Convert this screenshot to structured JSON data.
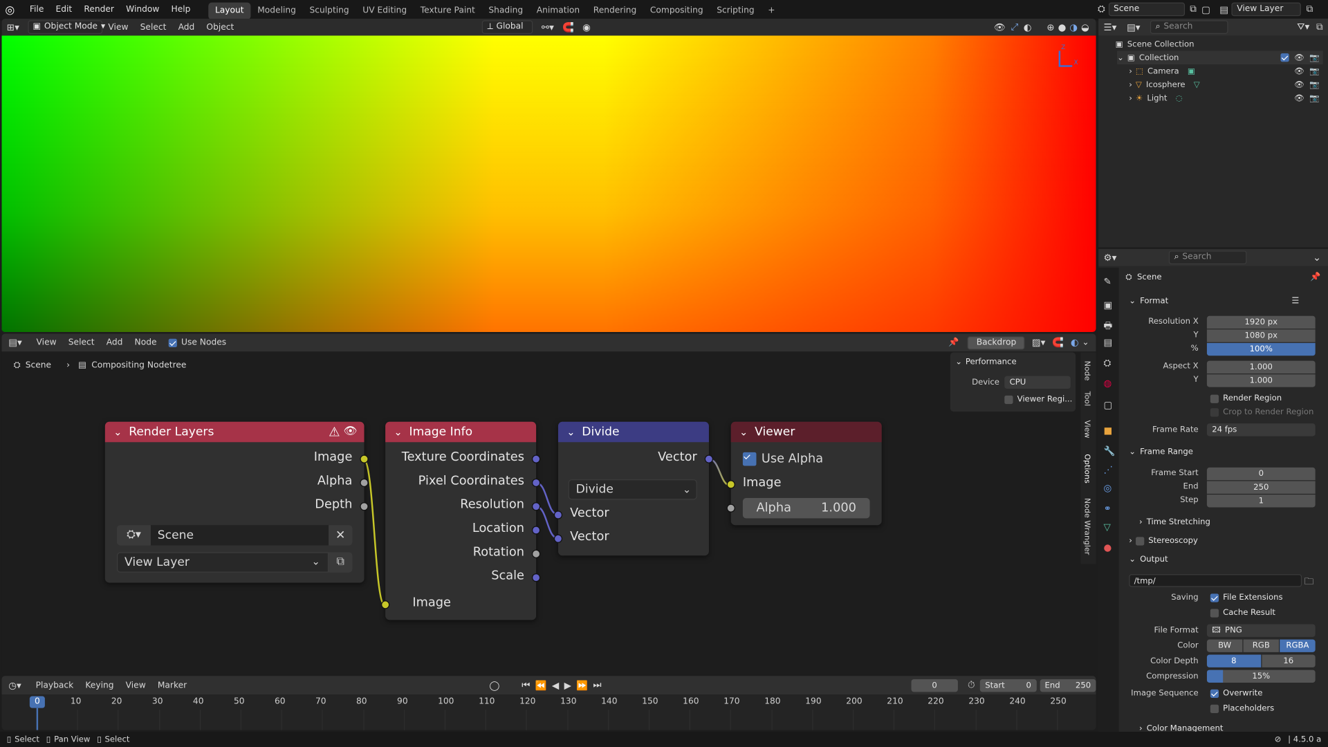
{
  "menubar": {
    "menus": [
      "File",
      "Edit",
      "Render",
      "Window",
      "Help"
    ],
    "workspaces": [
      "Layout",
      "Modeling",
      "Sculpting",
      "UV Editing",
      "Texture Paint",
      "Shading",
      "Animation",
      "Rendering",
      "Compositing",
      "Scripting"
    ],
    "active_workspace": "Layout",
    "add_tab": "+",
    "scene_name": "Scene",
    "view_layer": "View Layer"
  },
  "viewport": {
    "mode": "Object Mode",
    "menus": [
      "View",
      "Select",
      "Add",
      "Object"
    ],
    "orientation": "Global",
    "axis_z": "Z",
    "axis_x": "X"
  },
  "outliner": {
    "search_placeholder": "Search",
    "scene_collection": "Scene Collection",
    "collection": "Collection",
    "objects": [
      "Camera",
      "Icosphere",
      "Light"
    ]
  },
  "properties": {
    "search_placeholder": "Search",
    "context": "Scene",
    "format": {
      "header": "Format",
      "resolution_x_label": "Resolution X",
      "resolution_x": "1920 px",
      "y_label": "Y",
      "resolution_y": "1080 px",
      "pct_label": "%",
      "resolution_pct": "100%",
      "aspect_x_label": "Aspect X",
      "aspect_x": "1.000",
      "aspect_y_label": "Y",
      "aspect_y": "1.000",
      "render_region": "Render Region",
      "crop_region": "Crop to Render Region",
      "frame_rate_label": "Frame Rate",
      "frame_rate": "24 fps"
    },
    "frame_range": {
      "header": "Frame Range",
      "start_label": "Frame Start",
      "start": "0",
      "end_label": "End",
      "end": "250",
      "step_label": "Step",
      "step": "1"
    },
    "time_stretching": "Time Stretching",
    "stereoscopy": "Stereoscopy",
    "output": {
      "header": "Output",
      "path": "/tmp/",
      "saving_label": "Saving",
      "file_extensions": "File Extensions",
      "cache_result": "Cache Result",
      "file_format_label": "File Format",
      "file_format": "PNG",
      "color_label": "Color",
      "color_options": [
        "BW",
        "RGB",
        "RGBA"
      ],
      "color_selected": "RGBA",
      "depth_label": "Color Depth",
      "depth_options": [
        "8",
        "16"
      ],
      "depth_selected": "8",
      "compression_label": "Compression",
      "compression": "15%",
      "compression_value": 0.15,
      "image_sequence_label": "Image Sequence",
      "overwrite": "Overwrite",
      "placeholders": "Placeholders"
    },
    "color_management": "Color Management"
  },
  "node_editor": {
    "menus": [
      "View",
      "Select",
      "Add",
      "Node"
    ],
    "use_nodes": "Use Nodes",
    "backdrop": "Backdrop",
    "breadcrumb_scene": "Scene",
    "breadcrumb_tree": "Compositing Nodetree",
    "performance": {
      "header": "Performance",
      "device_label": "Device",
      "device": "CPU",
      "viewer_region": "Viewer Regi..."
    },
    "side_tabs": [
      "Node",
      "Tool",
      "View",
      "Options",
      "Node Wrangler"
    ],
    "nodes": {
      "render_layers": {
        "title": "Render Layers",
        "outputs": [
          "Image",
          "Alpha",
          "Depth"
        ],
        "scene": "Scene",
        "view_layer": "View Layer"
      },
      "image_info": {
        "title": "Image Info",
        "outputs": [
          "Texture Coordinates",
          "Pixel Coordinates",
          "Resolution",
          "Location",
          "Rotation",
          "Scale"
        ],
        "input": "Image"
      },
      "divide": {
        "title": "Divide",
        "output": "Vector",
        "operation": "Divide",
        "inputs": [
          "Vector",
          "Vector"
        ]
      },
      "viewer": {
        "title": "Viewer",
        "use_alpha": "Use Alpha",
        "input": "Image",
        "alpha_label": "Alpha",
        "alpha": "1.000"
      }
    }
  },
  "timeline": {
    "menus": [
      "Playback",
      "Keying",
      "View",
      "Marker"
    ],
    "current_frame": "0",
    "start_label": "Start",
    "start": "0",
    "end_label": "End",
    "end": "250",
    "ticks": [
      "0",
      "10",
      "20",
      "30",
      "40",
      "50",
      "60",
      "70",
      "80",
      "90",
      "100",
      "110",
      "120",
      "130",
      "140",
      "150",
      "160",
      "170",
      "180",
      "190",
      "200",
      "210",
      "220",
      "230",
      "240",
      "250"
    ]
  },
  "statusbar": {
    "items": [
      "Select",
      "Pan View",
      "Select"
    ],
    "version": "4.5.0 a"
  },
  "colors": {
    "accent": "#4772b3",
    "render_layers_header": "#a63348",
    "image_info_header": "#a63348",
    "divide_header": "#3c3c83",
    "viewer_header": "#5c1f2b",
    "socket_image": "#c7c729",
    "socket_vector": "#6363c7",
    "socket_value": "#a1a1a1"
  }
}
